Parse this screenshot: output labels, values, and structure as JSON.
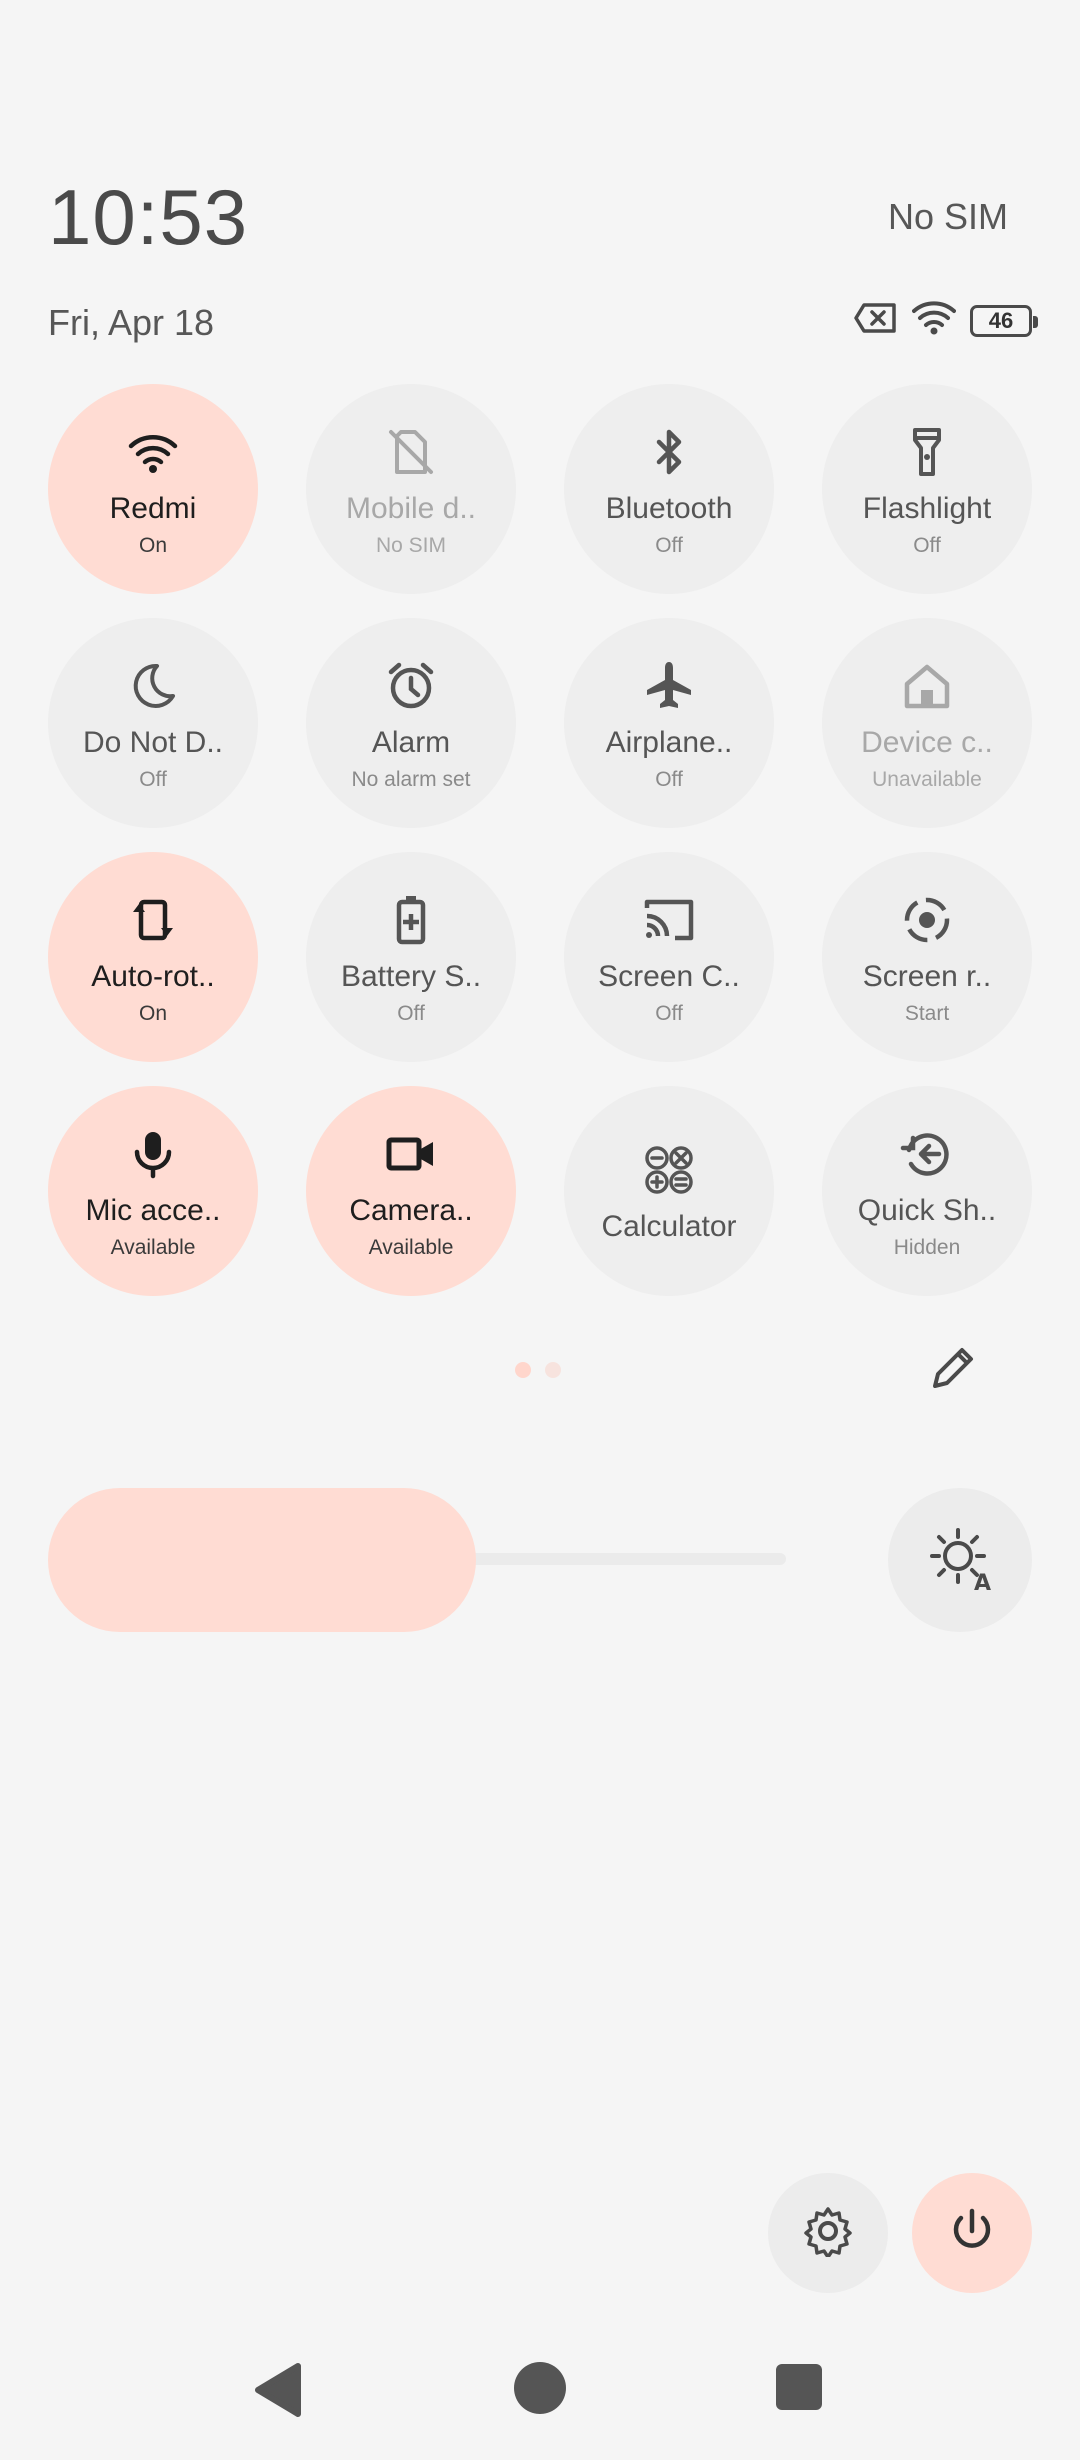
{
  "header": {
    "time": "10:53",
    "carrier": "No SIM",
    "date": "Fri, Apr 18",
    "battery_level": "46"
  },
  "tiles": [
    {
      "label": "Redmi",
      "sub": "On",
      "icon": "wifi-icon",
      "active": true
    },
    {
      "label": "Mobile d..",
      "sub": "No SIM",
      "icon": "mobile-data-off-icon",
      "active": false
    },
    {
      "label": "Bluetooth",
      "sub": "Off",
      "icon": "bluetooth-icon",
      "active": false
    },
    {
      "label": "Flashlight",
      "sub": "Off",
      "icon": "flashlight-icon",
      "active": false
    },
    {
      "label": "Do Not D..",
      "sub": "Off",
      "icon": "moon-icon",
      "active": false
    },
    {
      "label": "Alarm",
      "sub": "No alarm set",
      "icon": "alarm-icon",
      "active": false
    },
    {
      "label": "Airplane..",
      "sub": "Off",
      "icon": "airplane-icon",
      "active": false
    },
    {
      "label": "Device c..",
      "sub": "Unavailable",
      "icon": "home-icon",
      "active": false
    },
    {
      "label": "Auto-rot..",
      "sub": "On",
      "icon": "rotate-icon",
      "active": true
    },
    {
      "label": "Battery S..",
      "sub": "Off",
      "icon": "battery-saver-icon",
      "active": false
    },
    {
      "label": "Screen C..",
      "sub": "Off",
      "icon": "cast-icon",
      "active": false
    },
    {
      "label": "Screen r..",
      "sub": "Start",
      "icon": "screen-record-icon",
      "active": false
    },
    {
      "label": "Mic acce..",
      "sub": "Available",
      "icon": "mic-icon",
      "active": true
    },
    {
      "label": "Camera..",
      "sub": "Available",
      "icon": "camera-icon",
      "active": true
    },
    {
      "label": "Calculator",
      "sub": "",
      "icon": "calculator-icon",
      "active": false
    },
    {
      "label": "Quick Sh..",
      "sub": "Hidden",
      "icon": "quick-share-icon",
      "active": false
    }
  ],
  "pager": {
    "pages": 2,
    "current": 1
  },
  "brightness": {
    "level_percent": 58
  },
  "colors": {
    "accent": "#ffdcd3",
    "tile_bg": "#eeeeee",
    "background": "#f5f5f5"
  }
}
